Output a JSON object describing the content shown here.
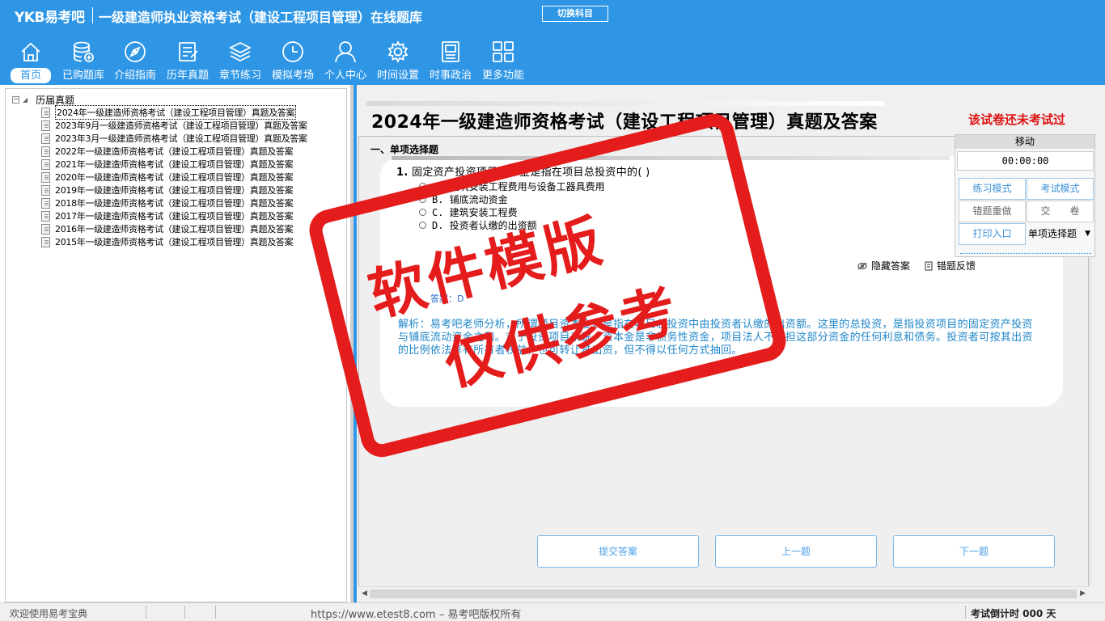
{
  "header": {
    "logo": "YKB易考吧",
    "title": "一级建造师执业资格考试（建设工程项目管理）在线题库",
    "switch_label": "切换科目"
  },
  "nav": [
    {
      "label": "首页",
      "icon": "home-icon",
      "active": true
    },
    {
      "label": "已购题库",
      "icon": "database-icon"
    },
    {
      "label": "介绍指南",
      "icon": "compass-icon"
    },
    {
      "label": "历年真题",
      "icon": "list-document-icon"
    },
    {
      "label": "章节练习",
      "icon": "layers-icon"
    },
    {
      "label": "模拟考场",
      "icon": "clock-icon"
    },
    {
      "label": "个人中心",
      "icon": "user-icon"
    },
    {
      "label": "时间设置",
      "icon": "gear-icon"
    },
    {
      "label": "时事政治",
      "icon": "news-icon"
    },
    {
      "label": "更多功能",
      "icon": "grid-icon"
    }
  ],
  "tree": {
    "root": "历届真题",
    "items": [
      "2024年一级建造师资格考试（建设工程项目管理）真题及答案",
      "2023年9月一级建造师资格考试（建设工程项目管理）真题及答案",
      "2023年3月一级建造师资格考试（建设工程项目管理）真题及答案",
      "2022年一级建造师资格考试（建设工程项目管理）真题及答案",
      "2021年一级建造师资格考试（建设工程项目管理）真题及答案",
      "2020年一级建造师资格考试（建设工程项目管理）真题及答案",
      "2019年一级建造师资格考试（建设工程项目管理）真题及答案",
      "2018年一级建造师资格考试（建设工程项目管理）真题及答案",
      "2017年一级建造师资格考试（建设工程项目管理）真题及答案",
      "2016年一级建造师资格考试（建设工程项目管理）真题及答案",
      "2015年一级建造师资格考试（建设工程项目管理）真题及答案"
    ]
  },
  "paper": {
    "title": "2024年一级建造师资格考试（建设工程项目管理）真题及答案",
    "status": "该试卷还未考试过",
    "section": "一、单项选择题"
  },
  "question": {
    "number": "1.",
    "text": "固定资产投资项目资本金是指在项目总投资中的(  )",
    "options": [
      "A. 建筑安装工程费用与设备工器具费用",
      "B. 铺底流动资金",
      "C. 建筑安装工程费",
      "D. 投资者认缴的出资额"
    ],
    "hide_answer": "隐藏答案",
    "error_feedback": "错题反馈",
    "answer": "答案：D",
    "analysis": "解析：易考吧老师分析，所谓项目资本金，是指在项目总投资中由投资者认缴的出资额。这里的总投资，是指投资项目的固定资产投资与铺底流动资金之和。对于投资项目来说，资本金是非债务性资金，项目法人不承担这部分资金的任何利息和债务。投资者可按其出资的比例依法享有所有者权益，也可转让其出资，但不得以任何方式抽回。"
  },
  "buttons": {
    "submit": "提交答案",
    "prev": "上一题",
    "next": "下一题"
  },
  "panel": {
    "move": "移动",
    "timer": "00:00:00",
    "practice": "练习模式",
    "exam": "考试模式",
    "redo": "错题重做",
    "hand_in": "交　　卷",
    "print": "打印入口",
    "type_select": "单项选择题"
  },
  "statusbar": {
    "welcome": "欢迎使用易考宝典",
    "copyright": "https://www.etest8.com – 易考吧版权所有",
    "countdown": "考试倒计时 000 天"
  },
  "watermark": {
    "line1": "软件模版",
    "line2": "仅供参考"
  },
  "colors": {
    "brand": "#2f96e6",
    "stamp": "#e41c1c",
    "status_red": "#d11111",
    "analysis_blue": "#1f86c9"
  }
}
